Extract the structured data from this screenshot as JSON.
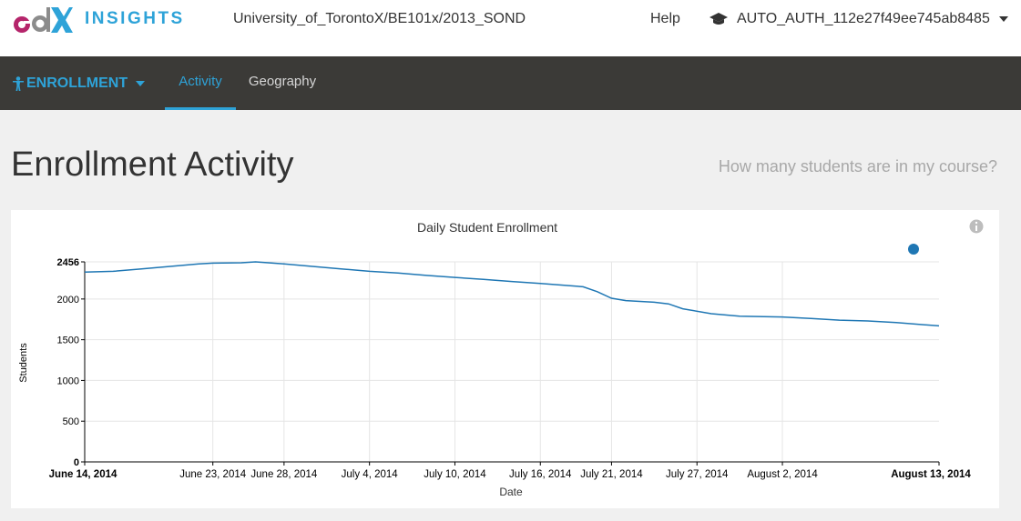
{
  "header": {
    "brand": "INSIGHTS",
    "course": "University_of_TorontoX/BE101x/2013_SOND",
    "help": "Help",
    "user": "AUTO_AUTH_112e27f49ee745ab8485",
    "colors": {
      "edx_logo_pink": "#b5256b",
      "edx_logo_blue": "#2ea3d8"
    }
  },
  "nav": {
    "section": "ENROLLMENT",
    "tabs": [
      {
        "label": "Activity",
        "active": true
      },
      {
        "label": "Geography",
        "active": false
      }
    ],
    "colors": {
      "bar": "#3b3a37",
      "accent": "#2ea3d8",
      "text": "#d6d6d6"
    }
  },
  "page": {
    "title": "Enrollment Activity",
    "question": "How many students are in my course?"
  },
  "chart_data": {
    "type": "line",
    "title": "Daily Student Enrollment",
    "xlabel": "Date",
    "ylabel": "Students",
    "ylim": [
      0,
      2456
    ],
    "y_ticks": [
      0,
      500,
      1000,
      1500,
      2000,
      2456
    ],
    "x_range": [
      "2014-06-14",
      "2014-08-13"
    ],
    "x_ticks": [
      {
        "date": "2014-06-14",
        "label": "June 14, 2014",
        "bold": true
      },
      {
        "date": "2014-06-23",
        "label": "June 23, 2014",
        "bold": false
      },
      {
        "date": "2014-06-28",
        "label": "June 28, 2014",
        "bold": false
      },
      {
        "date": "2014-07-04",
        "label": "July 4, 2014",
        "bold": false
      },
      {
        "date": "2014-07-10",
        "label": "July 10, 2014",
        "bold": false
      },
      {
        "date": "2014-07-16",
        "label": "July 16, 2014",
        "bold": false
      },
      {
        "date": "2014-07-21",
        "label": "July 21, 2014",
        "bold": false
      },
      {
        "date": "2014-07-27",
        "label": "July 27, 2014",
        "bold": false
      },
      {
        "date": "2014-08-02",
        "label": "August 2, 2014",
        "bold": false
      },
      {
        "date": "2014-08-13",
        "label": "August 13, 2014",
        "bold": true
      }
    ],
    "grid": true,
    "legend": "top-right",
    "series": [
      {
        "color": "#1f77b4",
        "points": [
          [
            "2014-06-14",
            2330
          ],
          [
            "2014-06-16",
            2340
          ],
          [
            "2014-06-18",
            2370
          ],
          [
            "2014-06-20",
            2400
          ],
          [
            "2014-06-22",
            2430
          ],
          [
            "2014-06-23",
            2440
          ],
          [
            "2014-06-25",
            2445
          ],
          [
            "2014-06-26",
            2456
          ],
          [
            "2014-06-28",
            2430
          ],
          [
            "2014-06-30",
            2400
          ],
          [
            "2014-07-02",
            2370
          ],
          [
            "2014-07-04",
            2340
          ],
          [
            "2014-07-06",
            2320
          ],
          [
            "2014-07-08",
            2290
          ],
          [
            "2014-07-10",
            2265
          ],
          [
            "2014-07-12",
            2240
          ],
          [
            "2014-07-14",
            2215
          ],
          [
            "2014-07-16",
            2190
          ],
          [
            "2014-07-18",
            2165
          ],
          [
            "2014-07-19",
            2150
          ],
          [
            "2014-07-20",
            2090
          ],
          [
            "2014-07-21",
            2010
          ],
          [
            "2014-07-22",
            1980
          ],
          [
            "2014-07-24",
            1960
          ],
          [
            "2014-07-25",
            1940
          ],
          [
            "2014-07-26",
            1880
          ],
          [
            "2014-07-28",
            1820
          ],
          [
            "2014-07-30",
            1790
          ],
          [
            "2014-08-02",
            1780
          ],
          [
            "2014-08-04",
            1760
          ],
          [
            "2014-08-06",
            1740
          ],
          [
            "2014-08-08",
            1730
          ],
          [
            "2014-08-10",
            1710
          ],
          [
            "2014-08-13",
            1670
          ]
        ]
      }
    ]
  }
}
